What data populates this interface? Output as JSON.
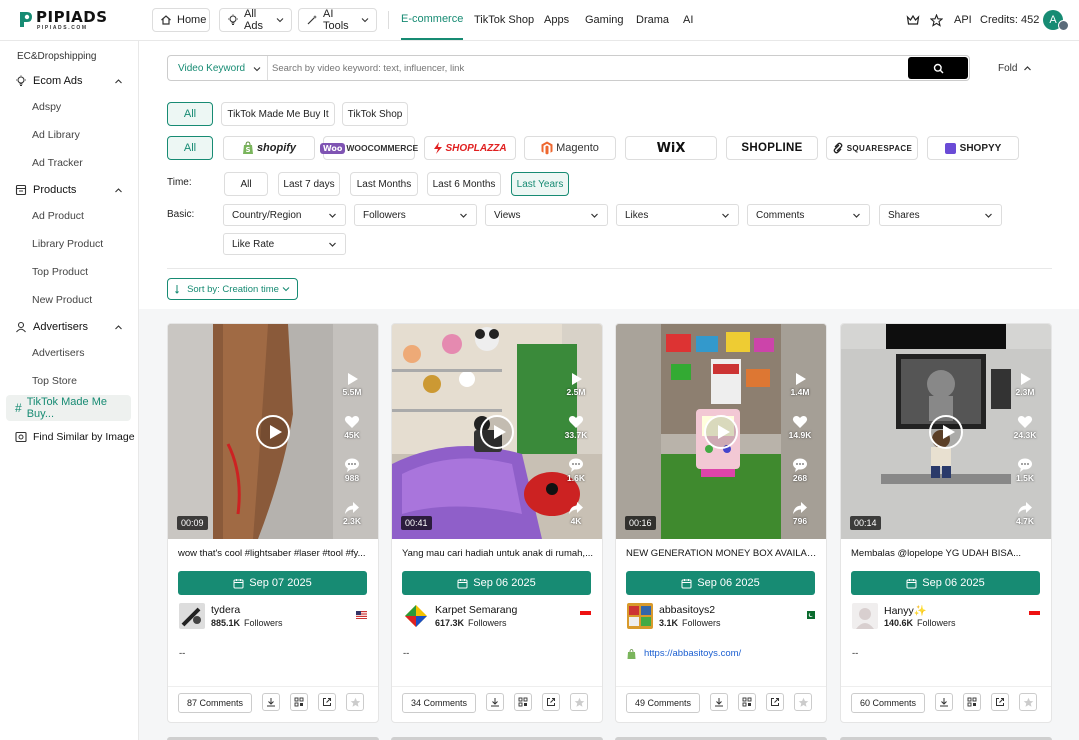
{
  "brand": {
    "name": "PIPIADS",
    "tagline": "PIPIADS.COM"
  },
  "header": {
    "home": "Home",
    "all_ads": "All Ads",
    "ai_tools": "AI Tools",
    "nav": [
      "E-commerce",
      "TikTok Shop",
      "Apps",
      "Gaming",
      "Drama",
      "AI"
    ],
    "api": "API",
    "credits": "Credits: 452",
    "avatar": "A"
  },
  "sidebar": {
    "section": "EC&Dropshipping",
    "ecom_ads": "Ecom Ads",
    "adspy": "Adspy",
    "ad_library": "Ad Library",
    "ad_tracker": "Ad Tracker",
    "products": "Products",
    "ad_product": "Ad Product",
    "library_product": "Library Product",
    "top_product": "Top Product",
    "new_product": "New Product",
    "advertisers": "Advertisers",
    "advertisers_sub": "Advertisers",
    "top_store": "Top Store",
    "tiktok_made": "TikTok Made Me Buy...",
    "find_similar": "Find Similar by Image"
  },
  "search": {
    "type": "Video Keyword",
    "placeholder": "Search by video keyword: text, influencer, link",
    "fold": "Fold"
  },
  "filters": {
    "source": [
      "All",
      "TikTok Made Me Buy It",
      "TikTok Shop"
    ],
    "platform_all": "All",
    "platforms": [
      "shopify",
      "WOOCOMMERCE",
      "SHOPLAZZA",
      "Magento",
      "WiX",
      "SHOPLINE",
      "SQUARESPACE",
      "SHOPYY"
    ],
    "time_label": "Time:",
    "time": [
      "All",
      "Last 7 days",
      "Last Months",
      "Last 6 Months",
      "Last Years"
    ],
    "basic_label": "Basic:",
    "basic": [
      "Country/Region",
      "Followers",
      "Views",
      "Likes",
      "Comments",
      "Shares",
      "Like Rate"
    ],
    "sort": "Sort by: Creation time"
  },
  "cards": [
    {
      "duration": "00:09",
      "views": "5.5M",
      "likes": "45K",
      "comments": "988",
      "shares": "2.3K",
      "title": "wow that's cool #lightsaber #laser #tool #fy...",
      "date": "Sep 07 2025",
      "name": "tydera",
      "followers": "885.1K",
      "followers_label": "Followers",
      "link": "--",
      "comments_btn": "87 Comments"
    },
    {
      "duration": "00:41",
      "views": "2.5M",
      "likes": "33.7K",
      "comments": "1.6K",
      "shares": "4K",
      "title": "Yang mau cari hadiah untuk anak di rumah,...",
      "date": "Sep 06 2025",
      "name": "Karpet Semarang",
      "followers": "617.3K",
      "followers_label": "Followers",
      "link": "--",
      "comments_btn": "34 Comments"
    },
    {
      "duration": "00:16",
      "views": "1.4M",
      "likes": "14.9K",
      "comments": "268",
      "shares": "796",
      "title": "NEW GENERATION MONEY BOX AVAILABL...",
      "date": "Sep 06 2025",
      "name": "abbasitoys2",
      "followers": "3.1K",
      "followers_label": "Followers",
      "link": "https://abbasitoys.com/",
      "comments_btn": "49 Comments"
    },
    {
      "duration": "00:14",
      "views": "2.3M",
      "likes": "24.3K",
      "comments": "1.5K",
      "shares": "4.7K",
      "title": "Membalas @lopelope YG UDAH BISA...",
      "date": "Sep 06 2025",
      "name": "Hanyy✨",
      "followers": "140.6K",
      "followers_label": "Followers",
      "link": "--",
      "comments_btn": "60 Comments"
    }
  ],
  "colors": {
    "accent": "#178b73",
    "link": "#1b5fd1"
  }
}
